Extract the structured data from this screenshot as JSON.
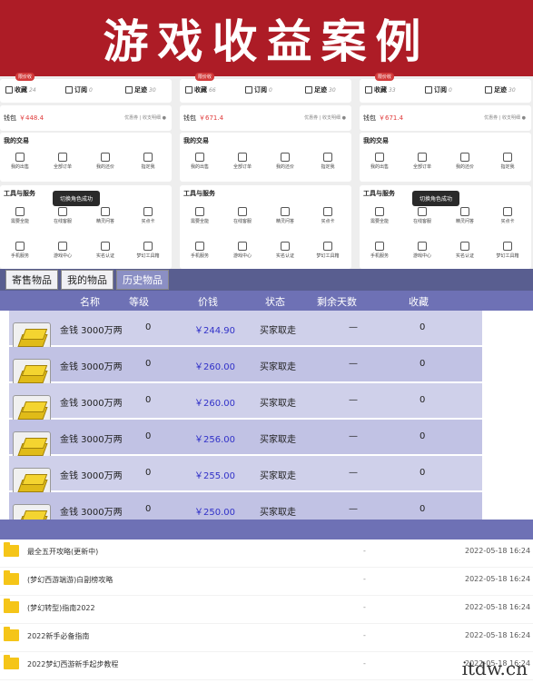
{
  "banner": {
    "title": "游戏收益案例"
  },
  "screens": [
    {
      "flag": "限价收",
      "fav": "收藏",
      "fav_n": "24",
      "sub": "订阅",
      "sub_n": "0",
      "trace": "足迹",
      "trace_n": "30",
      "wallet": "钱包",
      "amount": "￥448.4",
      "wallet_right": "优惠券 | 收支明细 ●",
      "trade_title": "我的交易",
      "trade_items": [
        "我的出售",
        "全部订单",
        "我的还价",
        "指定我"
      ],
      "tools_title": "工具与服务",
      "tools_row1": [
        "需要全能",
        "在线客服",
        "精灵问答",
        "买点卡"
      ],
      "tools_row2": [
        "手机服务",
        "游戏中心",
        "实名认证",
        "梦幻工具箱"
      ],
      "toast": "切换角色成功"
    },
    {
      "flag": "限价收",
      "fav": "收藏",
      "fav_n": "66",
      "sub": "订阅",
      "sub_n": "0",
      "trace": "足迹",
      "trace_n": "30",
      "wallet": "钱包",
      "amount": "￥671.4",
      "wallet_right": "优惠券 | 收支明细 ●",
      "trade_title": "我的交易",
      "trade_items": [
        "我的出售",
        "全部订单",
        "我的还价",
        "指定我"
      ],
      "tools_title": "工具与服务",
      "tools_row1": [
        "需要全能",
        "在线客服",
        "精灵问答",
        "买点卡"
      ],
      "tools_row2": [
        "手机服务",
        "游戏中心",
        "实名认证",
        "梦幻工具箱"
      ],
      "toast": ""
    },
    {
      "flag": "限价收",
      "fav": "收藏",
      "fav_n": "33",
      "sub": "订阅",
      "sub_n": "0",
      "trace": "足迹",
      "trace_n": "30",
      "wallet": "钱包",
      "amount": "￥671.4",
      "wallet_right": "优惠券 | 收支明细 ●",
      "trade_title": "我的交易",
      "trade_items": [
        "我的出售",
        "全部订单",
        "我的还价",
        "指定我"
      ],
      "tools_title": "工具与服务",
      "tools_row1": [
        "需要全能",
        "在线客服",
        "精灵问答",
        "买点卡"
      ],
      "tools_row2": [
        "手机服务",
        "游戏中心",
        "实名认证",
        "梦幻工具箱"
      ],
      "toast": "切换角色成功"
    }
  ],
  "tabs": [
    "寄售物品",
    "我的物品",
    "历史物品"
  ],
  "table": {
    "headers": [
      "名称",
      "等级",
      "价钱",
      "状态",
      "剩余天数",
      "收藏"
    ],
    "rows": [
      {
        "name": "金钱  3000万两",
        "level": "0",
        "price": "￥244.90",
        "status": "买家取走",
        "days": "—",
        "fav": "0"
      },
      {
        "name": "金钱  3000万两",
        "level": "0",
        "price": "￥260.00",
        "status": "买家取走",
        "days": "—",
        "fav": "0"
      },
      {
        "name": "金钱  3000万两",
        "level": "0",
        "price": "￥260.00",
        "status": "买家取走",
        "days": "—",
        "fav": "0"
      },
      {
        "name": "金钱  3000万两",
        "level": "0",
        "price": "￥256.00",
        "status": "买家取走",
        "days": "—",
        "fav": "0"
      },
      {
        "name": "金钱  3000万两",
        "level": "0",
        "price": "￥255.00",
        "status": "买家取走",
        "days": "—",
        "fav": "0"
      },
      {
        "name": "金钱  3000万两",
        "level": "0",
        "price": "￥250.00",
        "status": "买家取走",
        "days": "—",
        "fav": "0"
      }
    ]
  },
  "files": [
    {
      "name": "最全五开攻略(更新中)",
      "dash": "-",
      "date": "2022-05-18 16:24"
    },
    {
      "name": "(梦幻西游端游)白副榜攻略",
      "dash": "-",
      "date": "2022-05-18 16:24"
    },
    {
      "name": "(梦幻转型)指南2022",
      "dash": "-",
      "date": "2022-05-18 16:24"
    },
    {
      "name": "2022新手必备指南",
      "dash": "-",
      "date": "2022-05-18 16:24"
    },
    {
      "name": "2022梦幻西游新手起步教程",
      "dash": "-",
      "date": "2022-05-18 16:24"
    }
  ],
  "watermark": "itdw.cn"
}
